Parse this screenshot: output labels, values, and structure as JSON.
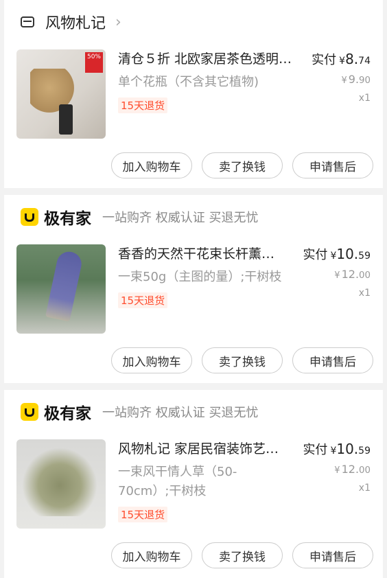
{
  "shops": [
    {
      "kind": "store",
      "name": "风物札记",
      "chevron": "›",
      "icon": "store-icon",
      "item": {
        "title": "清仓５折 北欧家居茶色透明…",
        "spec": "单个花瓶（不含其它植物)",
        "badge": "15天退货",
        "paid_label": "实付",
        "currency": "¥",
        "paid_int": "8.",
        "paid_dec": "74",
        "orig_int": "9.",
        "orig_dec": "90",
        "qty": "x1",
        "thumb_tag": "50%"
      },
      "buttons": [
        "加入购物车",
        "卖了换钱",
        "申请售后"
      ]
    },
    {
      "kind": "jyj",
      "name": "极有家",
      "slogan": "一站购齐 权威认证 买退无忧",
      "item": {
        "title": "香香的天然干花束长杆薰…",
        "spec": "一束50g（主图的量）;干树枝",
        "badge": "15天退货",
        "paid_label": "实付",
        "currency": "¥",
        "paid_int": "10.",
        "paid_dec": "59",
        "orig_int": "12.",
        "orig_dec": "00",
        "qty": "x1"
      },
      "buttons": [
        "加入购物车",
        "卖了换钱",
        "申请售后"
      ]
    },
    {
      "kind": "jyj",
      "name": "极有家",
      "slogan": "一站购齐 权威认证 买退无忧",
      "item": {
        "title": "风物札记 家居民宿装饰艺…",
        "spec": "一束风干情人草（50-70cm）;干树枝",
        "badge": "15天退货",
        "paid_label": "实付",
        "currency": "¥",
        "paid_int": "10.",
        "paid_dec": "59",
        "orig_int": "12.",
        "orig_dec": "00",
        "qty": "x1"
      },
      "buttons": [
        "加入购物车",
        "卖了换钱",
        "申请售后"
      ]
    }
  ],
  "colors": {
    "badge_text": "#ff4d2e",
    "badge_bg": "#fff1ec",
    "jyj_logo": "#ffd400"
  }
}
